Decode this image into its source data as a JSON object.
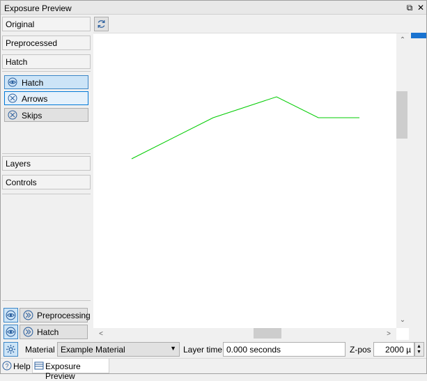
{
  "window": {
    "title": "Exposure Preview",
    "float_label": "⧉",
    "close_label": "✕"
  },
  "sidebar": {
    "sections": [
      {
        "label": "Original"
      },
      {
        "label": "Preprocessed"
      },
      {
        "label": "Hatch"
      }
    ],
    "hatch_toggles": [
      {
        "label": "Hatch",
        "icon": "eye-icon",
        "state": "checked"
      },
      {
        "label": "Arrows",
        "icon": "x-circle-icon",
        "state": "hover"
      },
      {
        "label": "Skips",
        "icon": "x-circle-icon",
        "state": "normal"
      }
    ],
    "lower_sections": [
      {
        "label": "Layers"
      },
      {
        "label": "Controls"
      }
    ],
    "bottom_controls": [
      {
        "label": "Preprocessing",
        "eye_icon": "eye-icon",
        "step_icon": "step-icon"
      },
      {
        "label": "Hatch",
        "eye_icon": "eye-icon",
        "step_icon": "step-icon"
      }
    ]
  },
  "toolbar": {
    "refresh_icon": "refresh-icon"
  },
  "preview": {
    "line_color": "#00cc00",
    "background": "#ffffff",
    "scroll_up": "⌃",
    "scroll_down": "⌄",
    "scroll_left": "<",
    "scroll_right": ">"
  },
  "bottom_bar": {
    "settings_icon": "gear-icon",
    "material_label": "Material",
    "material_value": "Example Material",
    "layer_time_label": "Layer time",
    "layer_time_value": "0.000 seconds",
    "zpos_label": "Z-pos",
    "zpos_value": "2000 µ"
  },
  "tabs": [
    {
      "label": "Help",
      "icon": "help-icon",
      "active": false
    },
    {
      "label": "Exposure Preview",
      "icon": "list-icon",
      "active": true
    }
  ],
  "colors": {
    "accent": "#0078d7",
    "selected_bg": "#cce4f7",
    "scroll_indicator": "#1a73d0"
  }
}
